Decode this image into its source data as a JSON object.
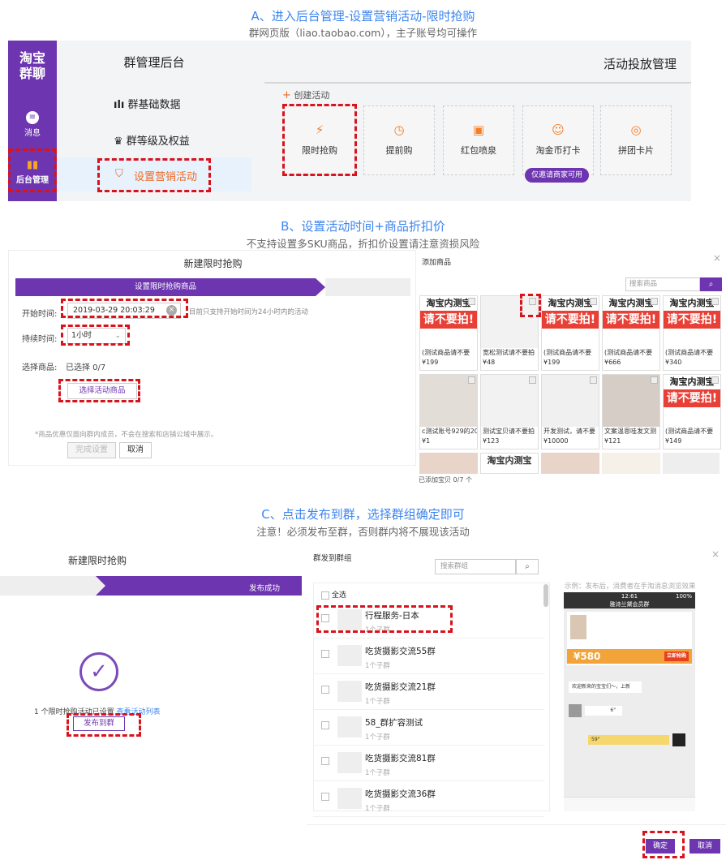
{
  "sectionA": {
    "title": "A、进入后台管理-设置营销活动-限时抢购",
    "subtitle": "群网页版（liao.taobao.com），主子账号均可操作",
    "logo": "淘宝\n群聊",
    "nav": [
      {
        "label": "消息",
        "icon": "message-icon"
      },
      {
        "label": "后台管理",
        "icon": "bar-chart-icon"
      }
    ],
    "menuTitle": "群管理后台",
    "menu": [
      {
        "label": "群基础数据"
      },
      {
        "label": "群等级及权益"
      },
      {
        "label": "设置营销活动"
      }
    ],
    "rightTitle": "活动投放管理",
    "create": "创建活动",
    "cards": [
      {
        "label": "限时抢购"
      },
      {
        "label": "提前购"
      },
      {
        "label": "红包喷泉"
      },
      {
        "label": "淘金币打卡"
      },
      {
        "label": "拼团卡片"
      }
    ],
    "merchantBadge": "仅邀请商家可用"
  },
  "sectionB": {
    "title": "B、设置活动时间+商品折扣价",
    "subtitle": "不支持设置多SKU商品，折扣价设置请注意资损风险",
    "formTitle": "新建限时抢购",
    "step": "设置限时抢购商品",
    "startLabel": "开始时间:",
    "startValue": "2019-03-29 20:03:29",
    "startHint": "目前只支持开始时间为24小时内的活动",
    "durationLabel": "持续时间:",
    "durationValue": "1小时",
    "selectLabel": "选择商品:",
    "selectedCount": "已选择 0/7",
    "selectBtn": "选择活动商品",
    "note": "*商品优惠仅面向群内成员，不会在搜索和店铺公域中展示。",
    "done": "完成设置",
    "cancel": "取消",
    "addTitle": "添加商品",
    "searchPh": "搜索商品",
    "close": "×",
    "adText1": "淘宝内测宝",
    "adText2": "请不要拍!",
    "products": [
      {
        "name": "(测试商品请不要",
        "price": "¥199",
        "ad": true
      },
      {
        "name": "宽松测试请不要拍",
        "price": "¥48",
        "ad": false
      },
      {
        "name": "(测试商品请不要",
        "price": "¥199",
        "ad": true
      },
      {
        "name": "(测试商品请不要",
        "price": "¥666",
        "ad": true
      },
      {
        "name": "(测试商品请不要",
        "price": "¥340",
        "ad": true
      },
      {
        "name": "c测试账号929的20",
        "price": "¥1",
        "ad": false
      },
      {
        "name": "测试宝贝请不要拍",
        "price": "¥123",
        "ad": false
      },
      {
        "name": "开发测试，请不要",
        "price": "¥10000",
        "ad": false
      },
      {
        "name": "文案温恩哇发文测",
        "price": "¥121",
        "ad": false
      },
      {
        "name": "(测试商品请不要",
        "price": "¥149",
        "ad": true
      }
    ],
    "addedCount": "已添加宝贝 0/7 个"
  },
  "sectionC": {
    "title": "C、点击发布到群，选择群组确定即可",
    "subtitle": "注意！必须发布至群，否则群内将不展现该活动",
    "formTitle": "新建限时抢购",
    "stepDone": "发布成功",
    "successText": "1 个限时抢购活动已设置",
    "viewList": "查看活动列表",
    "publishBtn": "发布到群",
    "dialogTitle": "群发到群组",
    "searchPh": "搜索群组",
    "selectAll": "全选",
    "groups": [
      {
        "name": "行程服务-日本",
        "sub": "1个子群"
      },
      {
        "name": "吃货摄影交流55群",
        "sub": "1个子群"
      },
      {
        "name": "吃货摄影交流21群",
        "sub": "1个子群"
      },
      {
        "name": "58_群扩容测试",
        "sub": "1个子群"
      },
      {
        "name": "吃货摄影交流81群",
        "sub": "1个子群"
      },
      {
        "name": "吃货摄影交流36群",
        "sub": "1个子群"
      }
    ],
    "previewNote": "示例：发布后，消费者在手淘消息浏览效果",
    "phone": {
      "time": "12:61",
      "battery": "100%",
      "group": "雅诗兰黛会员群",
      "price": "580",
      "buy": "立即抢购",
      "msg": "欢迎新来的宝宝们～，上新",
      "voice": "6\"",
      "voice2": "59\""
    },
    "confirm": "确定",
    "cancel": "取消"
  }
}
